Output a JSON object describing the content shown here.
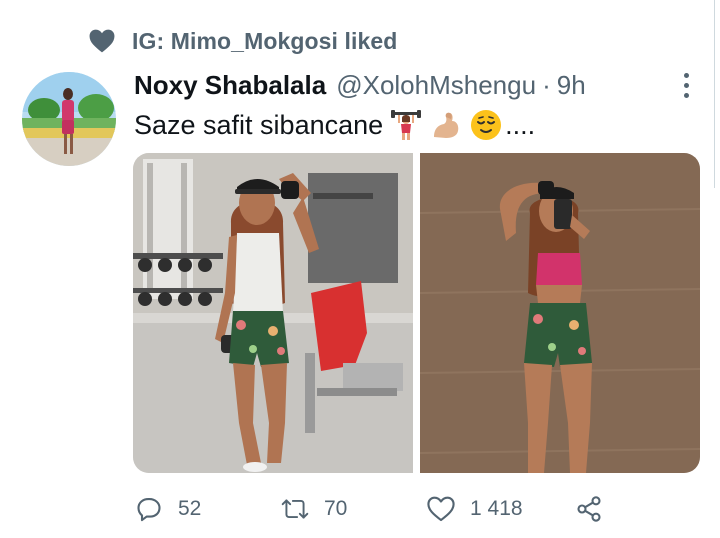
{
  "social_context": {
    "text": "IG: Mimo_Mokgosi liked",
    "icon": "heart-icon"
  },
  "tweet": {
    "author": {
      "display_name": "Noxy Shabalala",
      "handle": "@XolohMshengu"
    },
    "separator": "·",
    "time": "9h",
    "text": "Saze safit sibancane",
    "emojis": [
      "woman-lifting-weights-emoji",
      "flexed-biceps-emoji",
      "relieved-face-emoji"
    ],
    "trailing": "....",
    "media": [
      {
        "kind": "photo",
        "subject": "woman-in-gym"
      },
      {
        "kind": "photo",
        "subject": "woman-mirror-selfie"
      }
    ]
  },
  "actions": {
    "reply": {
      "icon": "reply-icon",
      "count": "52"
    },
    "retweet": {
      "icon": "retweet-icon",
      "count": "70"
    },
    "like": {
      "icon": "like-heart-icon",
      "count": "1 418"
    },
    "share": {
      "icon": "share-icon"
    }
  },
  "colors": {
    "text_primary": "#0f1419",
    "text_secondary": "#536471"
  }
}
